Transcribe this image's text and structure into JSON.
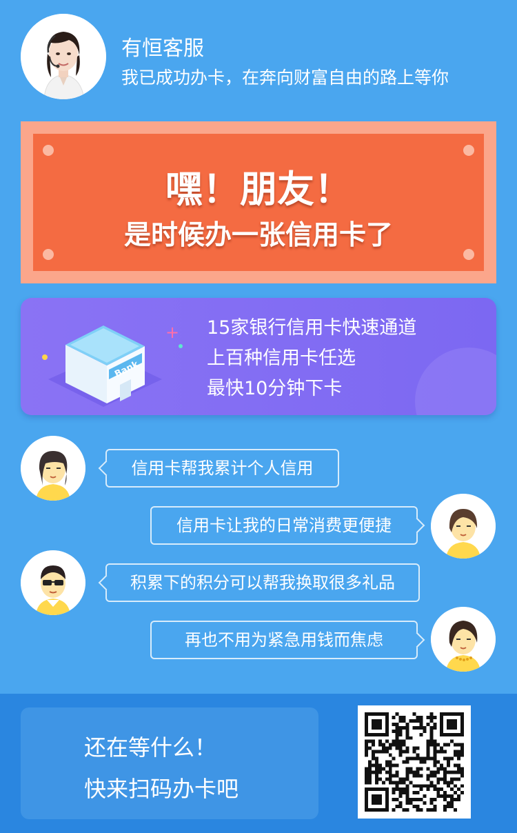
{
  "header": {
    "title": "有恒客服",
    "subtitle": "我已成功办卡，在奔向财富自由的路上等你"
  },
  "banner": {
    "line1": "嘿！朋友！",
    "line2": "是时候办一张信用卡了"
  },
  "bank_card": {
    "sign_text": "Bank",
    "lines": [
      "15家银行信用卡快速通道",
      "上百种信用卡任选",
      "最快10分钟下卡"
    ]
  },
  "chat": [
    {
      "text": "信用卡帮我累计个人信用",
      "side": "left"
    },
    {
      "text": "信用卡让我的日常消费更便捷",
      "side": "right"
    },
    {
      "text": "积累下的积分可以帮我换取很多礼品",
      "side": "left"
    },
    {
      "text": "再也不用为紧急用钱而焦虑",
      "side": "right"
    }
  ],
  "footer": {
    "cta_line1": "还在等什么！",
    "cta_line2": "快来扫码办卡吧"
  },
  "colors": {
    "background": "#4aa6ef",
    "banner": "#f46b42",
    "banner_border": "#fba68b",
    "bank_card": "#7c68f2",
    "footer": "#2a86e0"
  }
}
